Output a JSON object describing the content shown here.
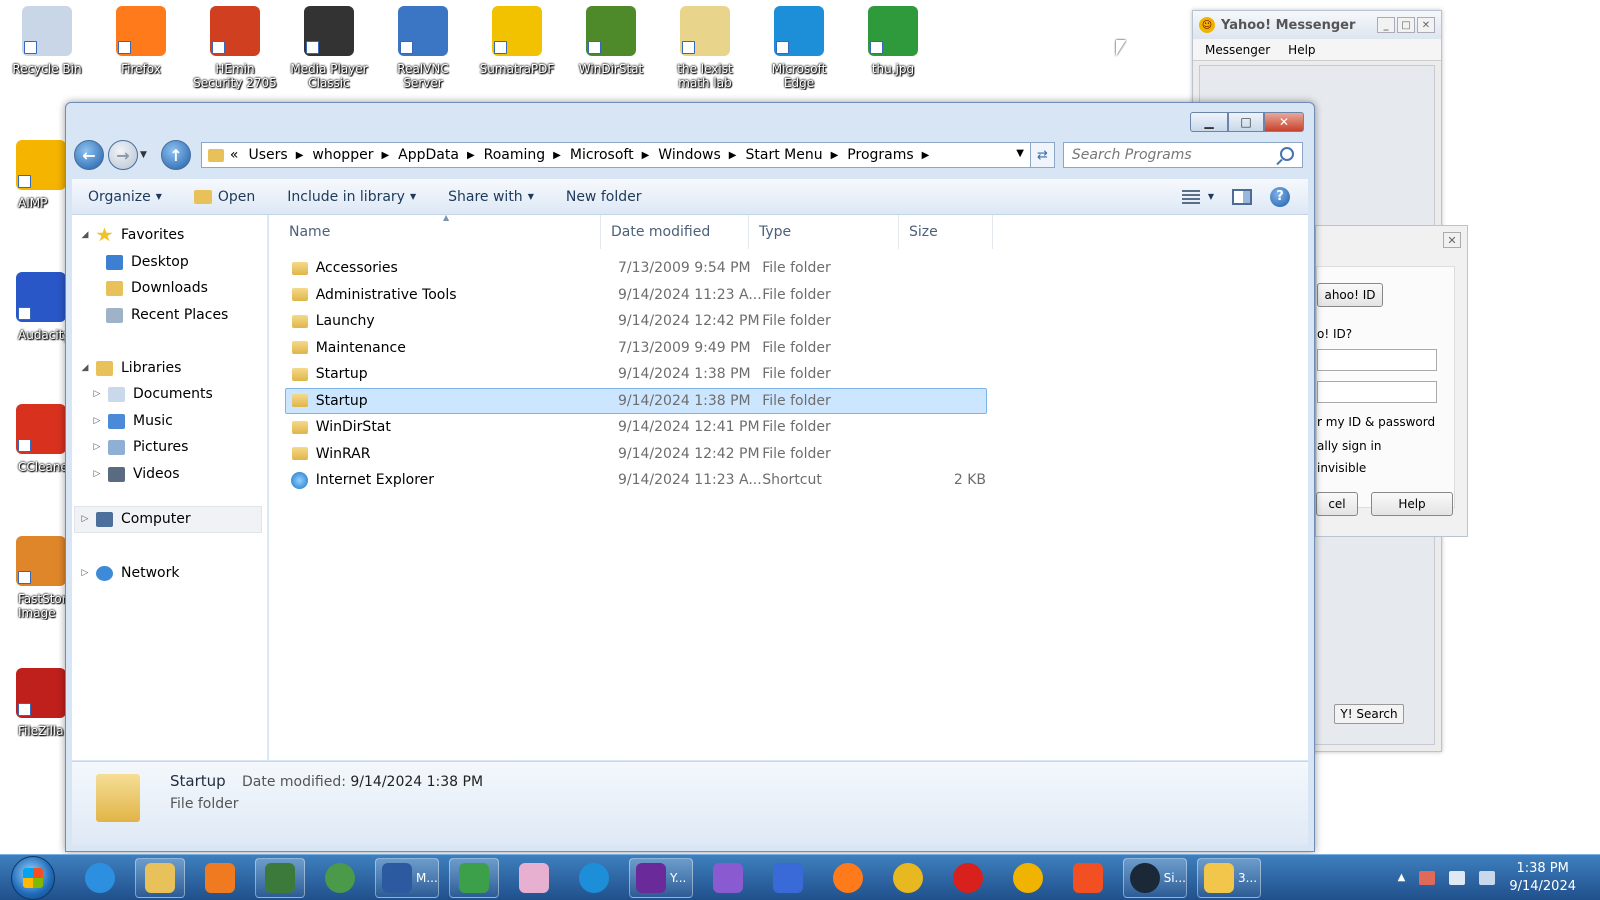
{
  "desktop": {
    "top_icons": [
      {
        "label": "Recycle Bin",
        "color": "#c8d6e8"
      },
      {
        "label": "Firefox",
        "color": "#ff7a1a"
      },
      {
        "label": "HEmin Security 2705",
        "color": "#d04020"
      },
      {
        "label": "Media Player Classic",
        "color": "#333333"
      },
      {
        "label": "RealVNC Server",
        "color": "#3a76c4"
      },
      {
        "label": "SumatraPDF",
        "color": "#f2c200"
      },
      {
        "label": "WinDirStat",
        "color": "#4f8a2a"
      },
      {
        "label": "the lexist math lab",
        "color": "#e9d48c"
      },
      {
        "label": "Microsoft Edge",
        "color": "#1c8fd8"
      },
      {
        "label": "thu.jpg",
        "color": "#2f9a3c"
      }
    ],
    "left_icons": [
      {
        "label": "AIMP",
        "color": "#f5b400"
      },
      {
        "label": "Audacity",
        "color": "#2a57c8"
      },
      {
        "label": "CCleaner",
        "color": "#d8321f"
      },
      {
        "label": "FastStone Image Viewer",
        "color": "#e0862a"
      },
      {
        "label": "FileZilla",
        "color": "#c0201c"
      }
    ]
  },
  "yahoo": {
    "title": "Yahoo! Messenger",
    "menu": [
      "Messenger",
      "Help"
    ],
    "search_button": "Y! Search",
    "dialog": {
      "id_button": "ahoo! ID",
      "question": "o! ID?",
      "remember": "r my ID & password",
      "auto": "ally sign in",
      "invisible": "invisible",
      "cancel": "cel",
      "help": "Help"
    }
  },
  "explorer": {
    "breadcrumb": [
      "Users",
      "whopper",
      "AppData",
      "Roaming",
      "Microsoft",
      "Windows",
      "Start Menu",
      "Programs"
    ],
    "breadcrumb_prefix": "«",
    "search_placeholder": "Search Programs",
    "toolbar": {
      "organize": "Organize",
      "open": "Open",
      "include": "Include in library",
      "share": "Share with",
      "newfolder": "New folder"
    },
    "nav": {
      "favorites": "Favorites",
      "desktop": "Desktop",
      "downloads": "Downloads",
      "recent": "Recent Places",
      "libraries": "Libraries",
      "documents": "Documents",
      "music": "Music",
      "pictures": "Pictures",
      "videos": "Videos",
      "computer": "Computer",
      "network": "Network"
    },
    "columns": {
      "name": "Name",
      "date": "Date modified",
      "type": "Type",
      "size": "Size"
    },
    "rows": [
      {
        "name": "Accessories",
        "date": "7/13/2009 9:54 PM",
        "type": "File folder",
        "size": ""
      },
      {
        "name": "Administrative Tools",
        "date": "9/14/2024 11:23 A...",
        "type": "File folder",
        "size": ""
      },
      {
        "name": "Launchy",
        "date": "9/14/2024 12:42 PM",
        "type": "File folder",
        "size": ""
      },
      {
        "name": "Maintenance",
        "date": "7/13/2009 9:49 PM",
        "type": "File folder",
        "size": ""
      },
      {
        "name": "Startup",
        "date": "9/14/2024 1:38 PM",
        "type": "File folder",
        "size": ""
      },
      {
        "name": "Startup",
        "date": "9/14/2024 1:38 PM",
        "type": "File folder",
        "size": ""
      },
      {
        "name": "WinDirStat",
        "date": "9/14/2024 12:41 PM",
        "type": "File folder",
        "size": ""
      },
      {
        "name": "WinRAR",
        "date": "9/14/2024 12:42 PM",
        "type": "File folder",
        "size": ""
      },
      {
        "name": "Internet Explorer",
        "date": "9/14/2024 11:23 A...",
        "type": "Shortcut",
        "size": "2 KB"
      }
    ],
    "details": {
      "name": "Startup",
      "modified_label": "Date modified:",
      "modified_value": "9/14/2024 1:38 PM",
      "type": "File folder"
    }
  },
  "taskbar": {
    "items": [
      {
        "name": "internet-explorer",
        "label": "",
        "color": "#2d8fe0"
      },
      {
        "name": "file-explorer",
        "label": "",
        "color": "#e8c15a"
      },
      {
        "name": "media-player",
        "label": "",
        "color": "#f07a20"
      },
      {
        "name": "task-manager",
        "label": "",
        "color": "#3c7a3c"
      },
      {
        "name": "browser-globe",
        "label": "",
        "color": "#4a9a4a"
      },
      {
        "name": "m-app",
        "label": "M...",
        "color": "#2c5aa0"
      },
      {
        "name": "users-app",
        "label": "",
        "color": "#3ca04a"
      },
      {
        "name": "paint",
        "label": "",
        "color": "#e8b0d0"
      },
      {
        "name": "edge",
        "label": "",
        "color": "#1c8fd8"
      },
      {
        "name": "yahoo",
        "label": "Y...",
        "color": "#6a2a9a"
      },
      {
        "name": "visual-studio",
        "label": "",
        "color": "#8a5ad0"
      },
      {
        "name": "feather-app",
        "label": "",
        "color": "#3a6ad8"
      },
      {
        "name": "firefox",
        "label": "",
        "color": "#ff7a1a"
      },
      {
        "name": "chrome",
        "label": "",
        "color": "#e8b820"
      },
      {
        "name": "opera",
        "label": "",
        "color": "#d8201c"
      },
      {
        "name": "ring-app",
        "label": "",
        "color": "#f0b400"
      },
      {
        "name": "windows-flag",
        "label": "",
        "color": "#f25022"
      },
      {
        "name": "steam",
        "label": "Si...",
        "color": "#1b2838"
      },
      {
        "name": "security-shield",
        "label": "3...",
        "color": "#f2c64a"
      }
    ],
    "time": "1:38 PM",
    "date": "9/14/2024"
  }
}
